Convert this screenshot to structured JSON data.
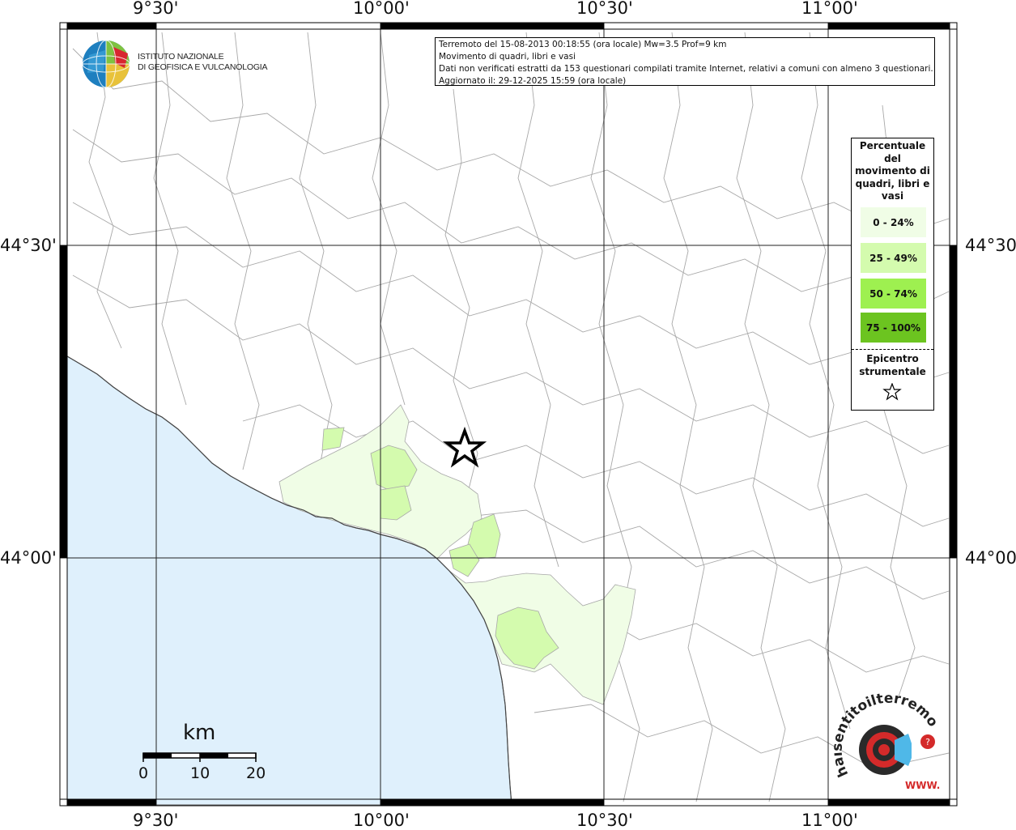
{
  "map": {
    "lon_ticks": [
      "9°30'",
      "10°00'",
      "10°30'",
      "11°00'"
    ],
    "lat_ticks": [
      "44°30'",
      "44°00'"
    ]
  },
  "info": {
    "line1": "Terremoto del 15-08-2013 00:18:55 (ora locale) Mw=3.5 Prof=9 km",
    "line2": "Movimento di quadri, libri e vasi",
    "line3": "Dati non verificati estratti da 153 questionari compilati tramite Internet, relativi a comuni con almeno 3 questionari.",
    "line4": "Aggiornato il: 29-12-2025 15:59 (ora locale)"
  },
  "legend": {
    "title": "Percentuale del movimento di quadri, libri e vasi",
    "classes": [
      {
        "label": "0 - 24%",
        "color": "#f0fde6"
      },
      {
        "label": "25 - 49%",
        "color": "#d4fbae"
      },
      {
        "label": "50 - 74%",
        "color": "#9ef050"
      },
      {
        "label": "75 - 100%",
        "color": "#6cc420"
      }
    ],
    "epicenter_label": "Epicentro strumentale"
  },
  "logo": {
    "ingv_line1": "ISTITUTO NAZIONALE",
    "ingv_line2": "DI GEOFISICA E VULCANOLOGIA",
    "hsit_text": "haisentitoilterremoto.it",
    "hsit_url": "WWW."
  },
  "scale": {
    "unit": "km",
    "labels": [
      "0",
      "10",
      "20"
    ]
  },
  "colors": {
    "sea": "#dff0fc",
    "border": "#a0a0a0",
    "grid": "#222222"
  }
}
